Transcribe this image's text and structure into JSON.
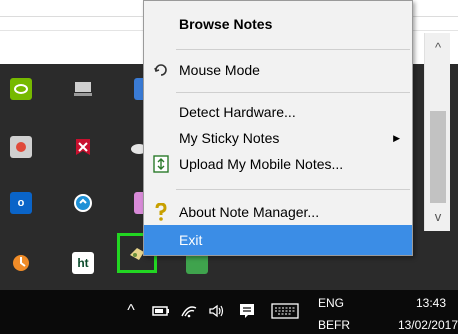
{
  "menu": {
    "items": [
      {
        "label": "Browse Notes",
        "icon": ""
      },
      {
        "label": "Mouse Mode",
        "icon": "mouse-mode-icon"
      },
      {
        "label": "Detect Hardware...",
        "icon": ""
      },
      {
        "label": "My Sticky Notes",
        "icon": "",
        "submenu": true
      },
      {
        "label": "Upload My Mobile Notes...",
        "icon": "upload-icon"
      },
      {
        "label": "About Note Manager...",
        "icon": "question-icon"
      },
      {
        "label": "Exit",
        "icon": "",
        "highlighted": true
      }
    ],
    "submenu_glyph": "▶"
  },
  "scrollbar": {
    "up_glyph": "^",
    "down_glyph": "v"
  },
  "tray": {
    "icons": [
      "nvidia-icon",
      "display-icon",
      "app-icon",
      "record-icon",
      "antivirus-icon",
      "cloud-icon",
      "outlook-icon",
      "circle-app-icon",
      "infinity-icon",
      "update-icon",
      "ht-icon",
      "note-manager-icon",
      "green-app-icon"
    ],
    "ht_label": "ht",
    "outlook_label": "o"
  },
  "taskbar": {
    "language_line1": "ENG",
    "language_line2": "BEFR",
    "time": "13:43",
    "date": "13/02/2017",
    "chevron_glyph": "^"
  },
  "colors": {
    "highlight": "#3b8de6",
    "selection_frame": "#22d622"
  }
}
